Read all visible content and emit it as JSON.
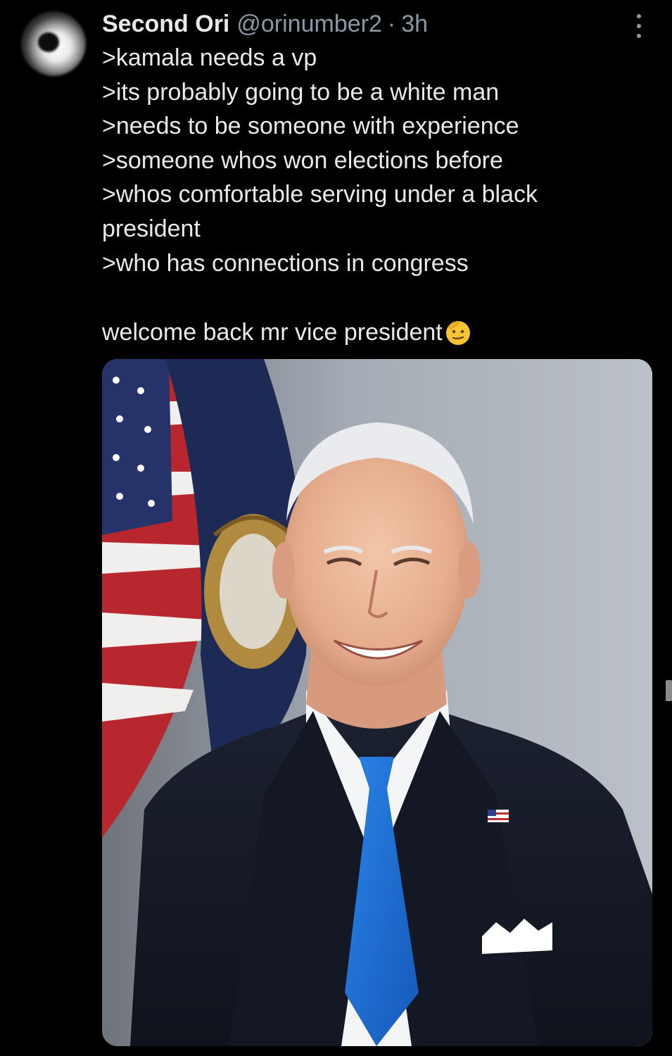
{
  "tweet": {
    "author": {
      "display_name": "Second Ori",
      "handle": "@orinumber2",
      "separator": "·",
      "timestamp": "3h"
    },
    "body_lines": [
      ">kamala needs a vp",
      ">its probably going to be a white man",
      ">needs to be someone with experience",
      ">someone whos won elections before",
      ">whos comfortable serving under a black",
      "president",
      ">who has connections in congress"
    ],
    "closing_line": "welcome back mr vice president",
    "closing_emoji": "saluting-face-emoji",
    "media": {
      "icon": "photo",
      "subject": "official-portrait"
    }
  },
  "colors": {
    "background": "#000000",
    "primary_text": "#e7e9ea",
    "secondary_text": "#8b98a5",
    "tie_blue": "#1f6fd1"
  }
}
